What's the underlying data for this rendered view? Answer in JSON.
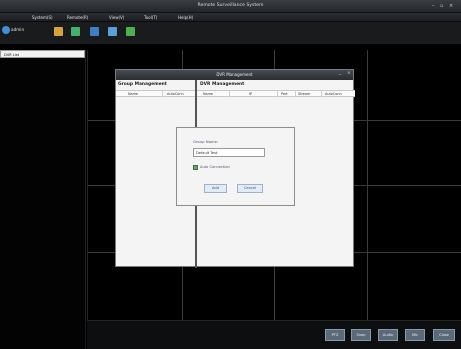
{
  "window": {
    "title": "Remote Surveillance System",
    "controls": [
      "–",
      "▫",
      "×"
    ]
  },
  "menu": {
    "items": [
      "System(S)",
      "Remote(R)",
      "View(V)",
      "Tool(T)",
      "Help(H)"
    ]
  },
  "toolbar": {
    "user": "admin",
    "icons": [
      "user-icon",
      "device-manage-icon",
      "record-icon",
      "log-icon",
      "config-icon",
      "alarm-icon"
    ]
  },
  "left_panel": {
    "header": "DVR List"
  },
  "dvr_dialog": {
    "title": "DVR Management",
    "controls": [
      "_",
      "×"
    ],
    "group_section": {
      "title": "Group Management",
      "columns": [
        "Name",
        "AutoConn"
      ]
    },
    "dvr_section": {
      "title": "DVR Management",
      "columns": [
        "Name",
        "IP",
        "Port",
        "Stream",
        "AutoConn"
      ]
    }
  },
  "group_dialog": {
    "name_label": "Group Name:",
    "name_value": "Default Test",
    "auto_label": "Auto Connection",
    "auto_checked": true,
    "add_label": "Add",
    "cancel_label": "Cancel"
  },
  "status_buttons": [
    "PTZ",
    "Snap",
    "Audio",
    "Mic",
    "Close"
  ],
  "colors": {
    "background": "#000000",
    "dialog_bg": "#f4f4f4",
    "accent": "#5b6a79"
  }
}
